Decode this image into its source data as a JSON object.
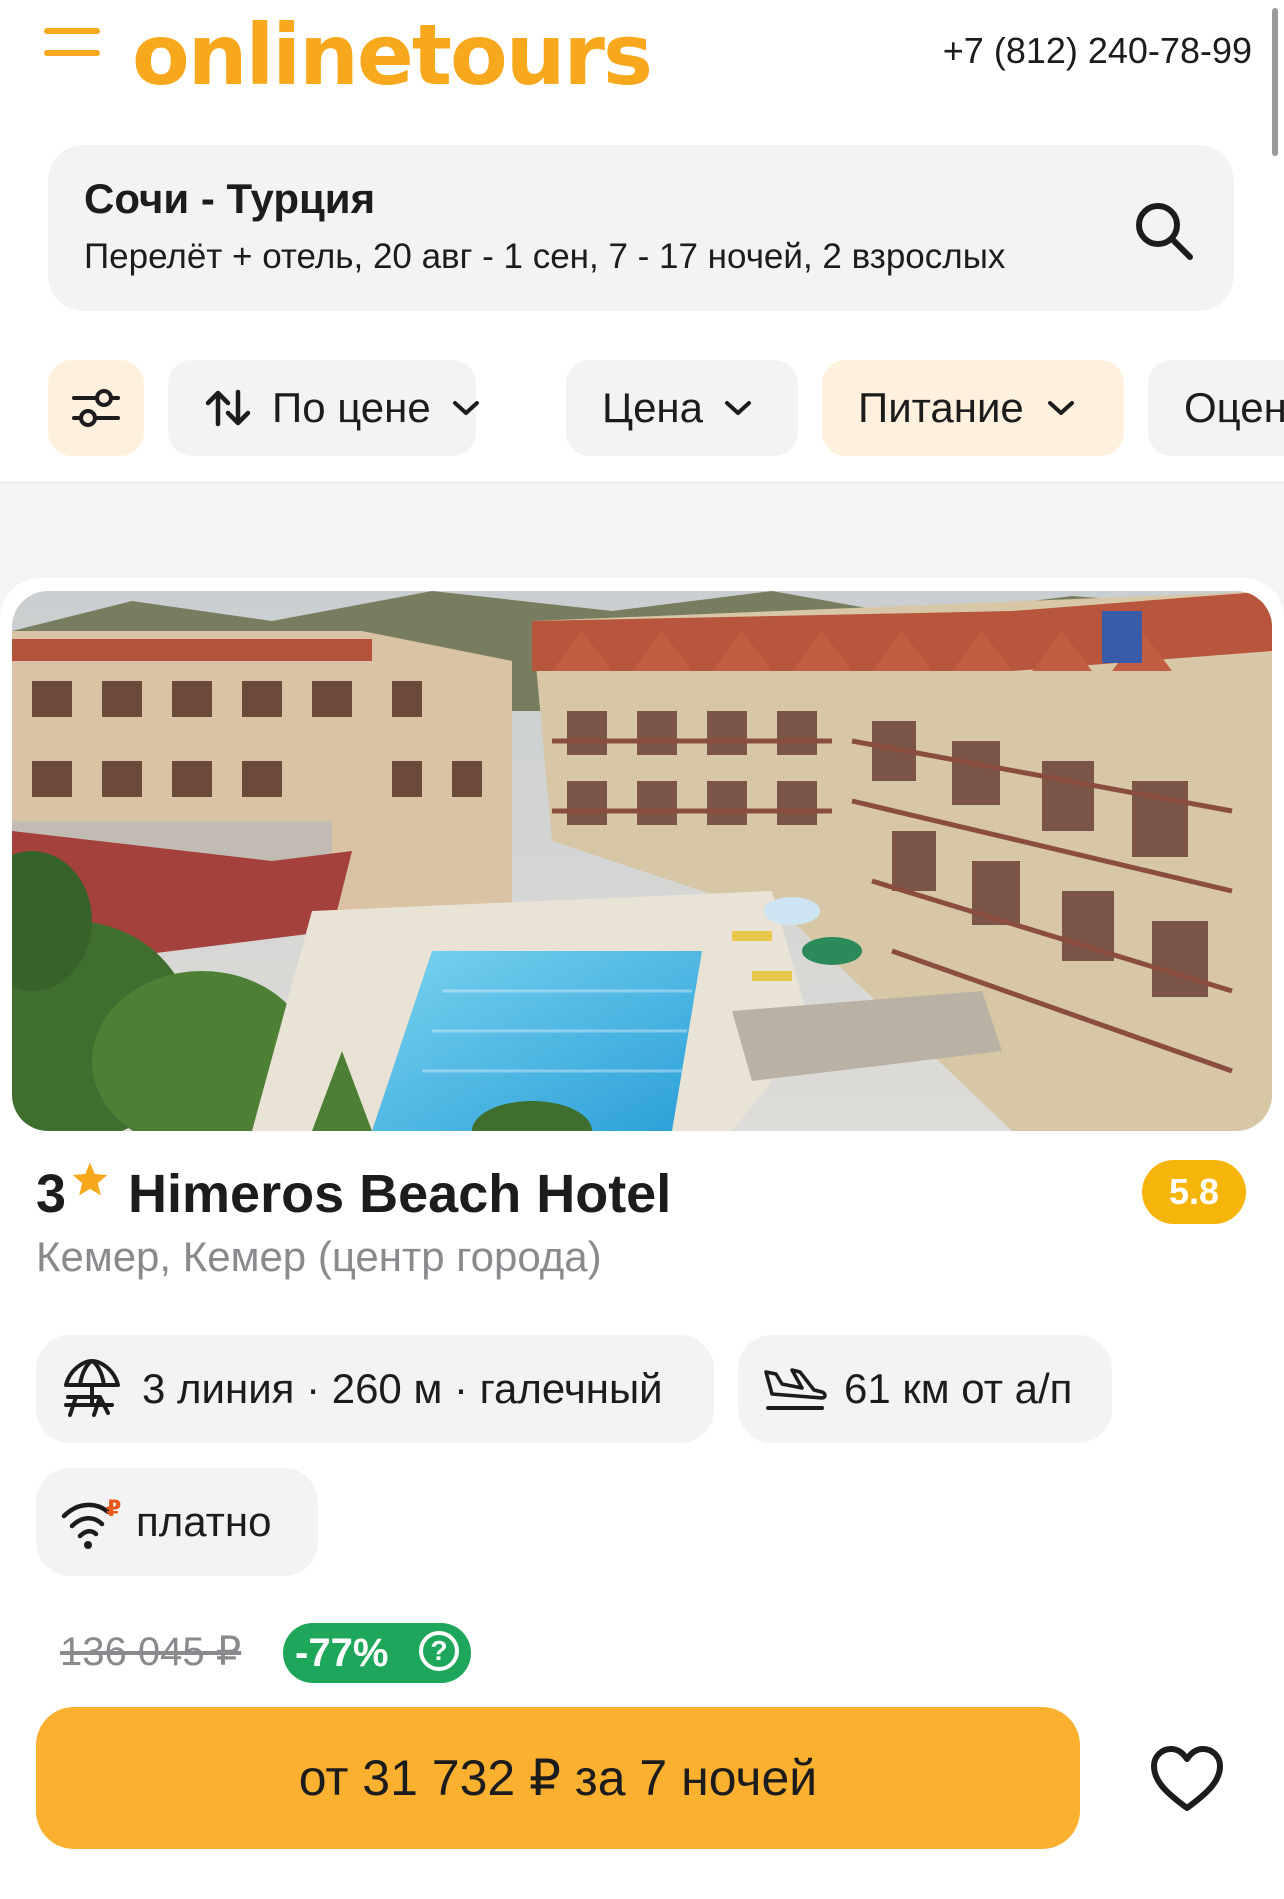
{
  "header": {
    "logo": "onlinetours",
    "phone": "+7 (812) 240-78-99",
    "menu_icon": "hamburger-menu-icon"
  },
  "search": {
    "title": "Сочи - Турция",
    "subtitle": "Перелёт + отель, 20 авг - 1 сен, 7 - 17 ночей, 2 взрослых",
    "icon": "search-icon"
  },
  "filters": {
    "settings_icon": "sliders-icon",
    "items": [
      {
        "label": "По цене",
        "icon": "sort-arrows-icon"
      },
      {
        "label": "Цена"
      },
      {
        "label": "Питание"
      },
      {
        "label": "Оцен"
      }
    ]
  },
  "hotel": {
    "stars": "3",
    "name": "Himeros Beach Hotel",
    "rating": "5.8",
    "location": "Кемер, Кемер (центр города)",
    "features": [
      {
        "icon": "beach-umbrella-icon",
        "text": "3 линия · 260 м · галечный"
      },
      {
        "icon": "plane-landing-icon",
        "text": "61 км от а/п"
      },
      {
        "icon": "wifi-paid-icon",
        "text": "платно"
      }
    ],
    "old_price": "136 045 ₽",
    "discount": "-77%",
    "discount_help": "?",
    "price_button": "от 31 732 ₽ за 7 ночей"
  },
  "colors": {
    "brand": "#f8a81c",
    "button": "#fbb030",
    "rating": "#f5b50a",
    "discount": "#1ea75a",
    "chip_active": "#fff1dd"
  }
}
